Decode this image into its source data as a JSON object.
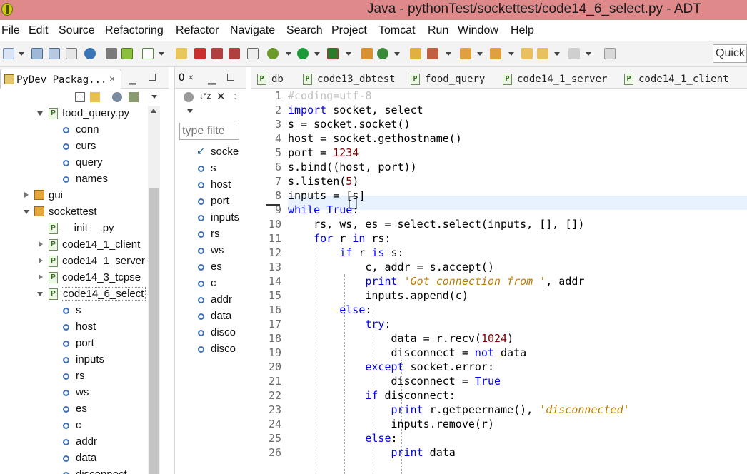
{
  "window": {
    "title": "Java - pythonTest/sockettest/code14_6_select.py - ADT"
  },
  "menu": [
    "File",
    "Edit",
    "Source",
    "Refactoring",
    "Refactor",
    "Navigate",
    "Search",
    "Project",
    "Tomcat",
    "Run",
    "Window",
    "Help"
  ],
  "quick_access": {
    "placeholder": "Quick"
  },
  "package_explorer": {
    "tab_label": "PyDev Packag...",
    "tree": [
      {
        "label": "food_query.py",
        "kind": "file",
        "expanded": true
      },
      {
        "label": "conn",
        "kind": "var"
      },
      {
        "label": "curs",
        "kind": "var"
      },
      {
        "label": "query",
        "kind": "var"
      },
      {
        "label": "names",
        "kind": "var"
      },
      {
        "label": "gui",
        "kind": "package",
        "expanded": false
      },
      {
        "label": "sockettest",
        "kind": "package",
        "expanded": true
      },
      {
        "label": "__init__.py",
        "kind": "file"
      },
      {
        "label": "code14_1_client",
        "kind": "file",
        "expanded": false
      },
      {
        "label": "code14_1_server",
        "kind": "file",
        "expanded": false
      },
      {
        "label": "code14_3_tcpse",
        "kind": "file",
        "expanded": false
      },
      {
        "label": "code14_6_select",
        "kind": "file",
        "expanded": true,
        "selected": true
      },
      {
        "label": "s",
        "kind": "var"
      },
      {
        "label": "host",
        "kind": "var"
      },
      {
        "label": "port",
        "kind": "var"
      },
      {
        "label": "inputs",
        "kind": "var"
      },
      {
        "label": "rs",
        "kind": "var"
      },
      {
        "label": "ws",
        "kind": "var"
      },
      {
        "label": "es",
        "kind": "var"
      },
      {
        "label": "c",
        "kind": "var"
      },
      {
        "label": "addr",
        "kind": "var"
      },
      {
        "label": "data",
        "kind": "var"
      },
      {
        "label": "disconnect",
        "kind": "var"
      }
    ]
  },
  "outline": {
    "tab_label": "O",
    "filter_placeholder": "type filte",
    "items": [
      "socke",
      "s",
      "host",
      "port",
      "inputs",
      "rs",
      "ws",
      "es",
      "c",
      "addr",
      "data",
      "disco",
      "disco"
    ]
  },
  "editor": {
    "tabs": [
      "db",
      "code13_dbtest",
      "food_query",
      "code14_1_server",
      "code14_1_client"
    ],
    "current_line": 7,
    "lines": [
      "#coding=utf-8",
      "import socket, select",
      "s = socket.socket()",
      "host = socket.gethostname()",
      "port = 1234",
      "s.bind((host, port))",
      "s.listen(5)",
      "inputs = [s]",
      "while True:",
      "    rs, ws, es = select.select(inputs, [], [])",
      "    for r in rs:",
      "        if r is s:",
      "            c, addr = s.accept()",
      "            print 'Got connection from ', addr",
      "            inputs.append(c)",
      "        else:",
      "            try:",
      "                data = r.recv(1024)",
      "                disconnect = not data",
      "            except socket.error:",
      "                disconnect = True",
      "            if disconnect:",
      "                print r.getpeername(), 'disconnected'",
      "                inputs.remove(r)",
      "            else:",
      "                print data"
    ]
  }
}
